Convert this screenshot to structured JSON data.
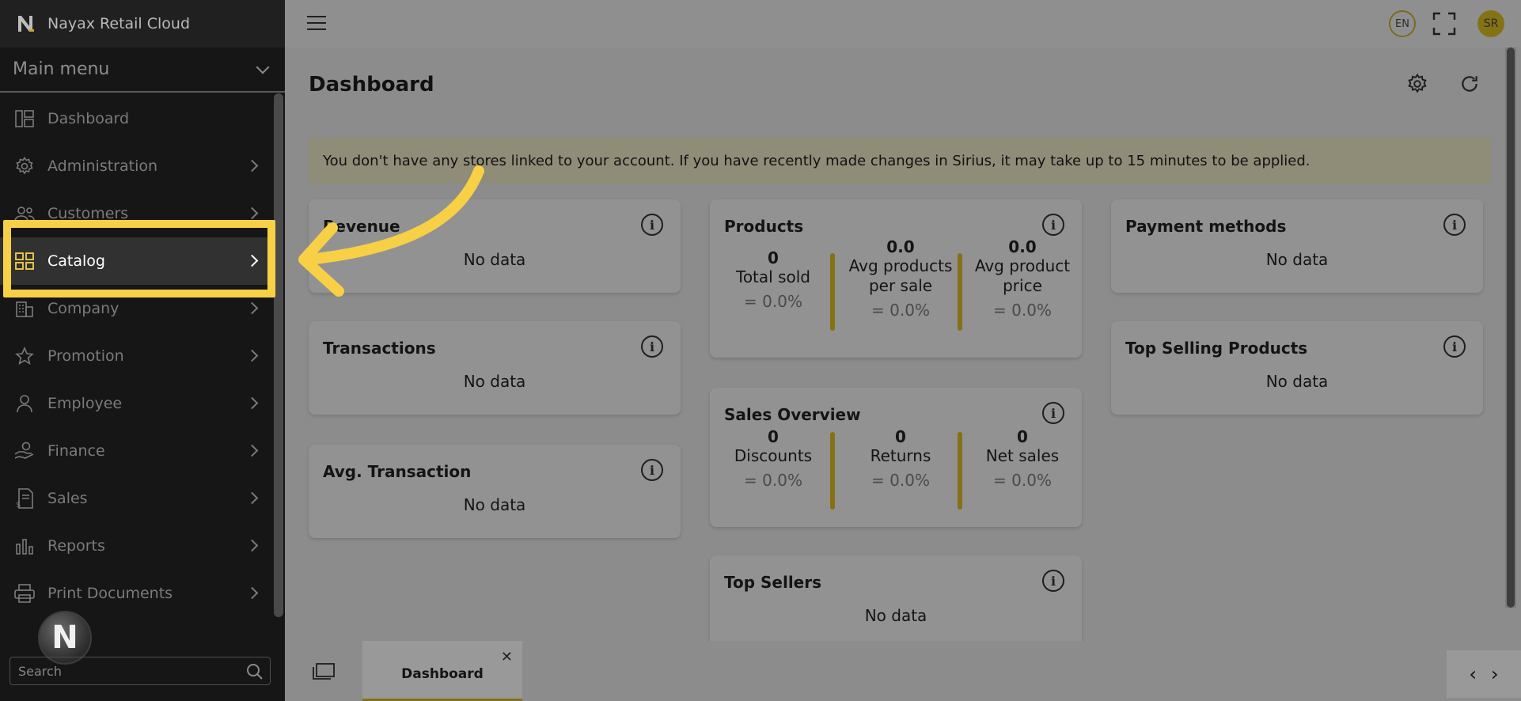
{
  "app": {
    "title": "Nayax Retail Cloud"
  },
  "sidebar": {
    "menu_header": "Main menu",
    "items": [
      {
        "label": "Dashboard",
        "icon": "dashboard-icon",
        "has_arrow": false
      },
      {
        "label": "Administration",
        "icon": "gear-icon",
        "has_arrow": true
      },
      {
        "label": "Customers",
        "icon": "users-icon",
        "has_arrow": true
      },
      {
        "label": "Catalog",
        "icon": "grid-icon",
        "has_arrow": true,
        "active": true
      },
      {
        "label": "Company",
        "icon": "building-icon",
        "has_arrow": true
      },
      {
        "label": "Promotion",
        "icon": "star-icon",
        "has_arrow": true
      },
      {
        "label": "Employee",
        "icon": "person-icon",
        "has_arrow": true
      },
      {
        "label": "Finance",
        "icon": "hand-coin-icon",
        "has_arrow": true
      },
      {
        "label": "Sales",
        "icon": "receipt-icon",
        "has_arrow": true
      },
      {
        "label": "Reports",
        "icon": "bar-chart-icon",
        "has_arrow": true
      },
      {
        "label": "Print Documents",
        "icon": "printer-icon",
        "has_arrow": true
      }
    ],
    "search_placeholder": "Search",
    "avatar_letter": "N"
  },
  "topbar": {
    "language": "EN",
    "user_initials": "SR"
  },
  "page": {
    "title": "Dashboard",
    "notice": "You don't have any stores linked to your account. If you have recently made changes in Sirius, it may take up to 15 minutes to be applied."
  },
  "cards": {
    "revenue": {
      "title": "Revenue",
      "body": "No data"
    },
    "transactions": {
      "title": "Transactions",
      "body": "No data"
    },
    "avg_transaction": {
      "title": "Avg. Transaction",
      "body": "No data"
    },
    "products": {
      "title": "Products",
      "metrics": [
        {
          "value": "0",
          "label": "Total sold",
          "pct": "= 0.0%"
        },
        {
          "value": "0.0",
          "label": "Avg products per sale",
          "pct": "= 0.0%"
        },
        {
          "value": "0.0",
          "label": "Avg product price",
          "pct": "= 0.0%"
        }
      ]
    },
    "sales_overview": {
      "title": "Sales Overview",
      "metrics": [
        {
          "value": "0",
          "label": "Discounts",
          "pct": "= 0.0%"
        },
        {
          "value": "0",
          "label": "Returns",
          "pct": "= 0.0%"
        },
        {
          "value": "0",
          "label": "Net sales",
          "pct": "= 0.0%"
        }
      ]
    },
    "top_sellers": {
      "title": "Top Sellers",
      "body": "No data"
    },
    "payment_methods": {
      "title": "Payment methods",
      "body": "No data"
    },
    "top_selling_products": {
      "title": "Top Selling Products",
      "body": "No data"
    }
  },
  "bottom_tabs": [
    {
      "label": "Dashboard"
    }
  ],
  "colors": {
    "accent": "#f7d046",
    "sidebar_bg": "#161616",
    "metric_bar": "#857016"
  }
}
